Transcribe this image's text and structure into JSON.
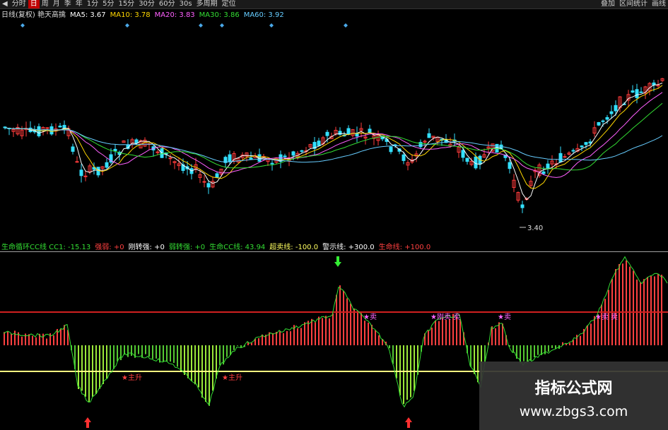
{
  "toolbar": {
    "items": [
      "◀",
      "分时",
      "日",
      "周",
      "月",
      "季",
      "年",
      "1分",
      "5分",
      "15分",
      "30分",
      "60分",
      "30s",
      "多周期",
      "定位"
    ],
    "active_index": 2,
    "right_items": [
      "叠加",
      "区间统计",
      "画线"
    ]
  },
  "price_legend": {
    "title": "日线(复权) 艳天高擒",
    "ma": [
      {
        "label": "MA5",
        "value": "3.67",
        "color": "#ffffff"
      },
      {
        "label": "MA10",
        "value": "3.78",
        "color": "#ffd700"
      },
      {
        "label": "MA20",
        "value": "3.83",
        "color": "#ff60ff"
      },
      {
        "label": "MA30",
        "value": "3.86",
        "color": "#33dd33"
      },
      {
        "label": "MA60",
        "value": "3.92",
        "color": "#66ccff"
      }
    ]
  },
  "low_marker": "3.40",
  "indicator_legend": {
    "items": [
      {
        "text": "生命循环CC线 CC1: -15.13",
        "color": "#33dd33"
      },
      {
        "text": "强弱: +0",
        "color": "#ff4040"
      },
      {
        "text": "刚转强: +0",
        "color": "#ffffff"
      },
      {
        "text": "弱转强: +0",
        "color": "#33dd33"
      },
      {
        "text": "生命CC线: 43.94",
        "color": "#33dd33"
      },
      {
        "text": "超卖线: -100.0",
        "color": "#ffff60"
      },
      {
        "text": "警示线: +300.0",
        "color": "#ffffff"
      },
      {
        "text": "生命线: +100.0",
        "color": "#ff4040"
      }
    ]
  },
  "signals": {
    "sell_labels": [
      "卖",
      "刚卖 卖",
      "卖",
      "卖 卖"
    ],
    "buy_labels": [
      "主升",
      "主升"
    ]
  },
  "watermark": {
    "title": "指标公式网",
    "url": "www.zbgs3.com"
  },
  "chart_data": {
    "type": "candlestick",
    "price_min": 3.4,
    "moving_averages": [
      "MA5",
      "MA10",
      "MA20",
      "MA30",
      "MA60"
    ],
    "indicator_levels": {
      "life_line": 100,
      "oversold_line": -100
    }
  }
}
